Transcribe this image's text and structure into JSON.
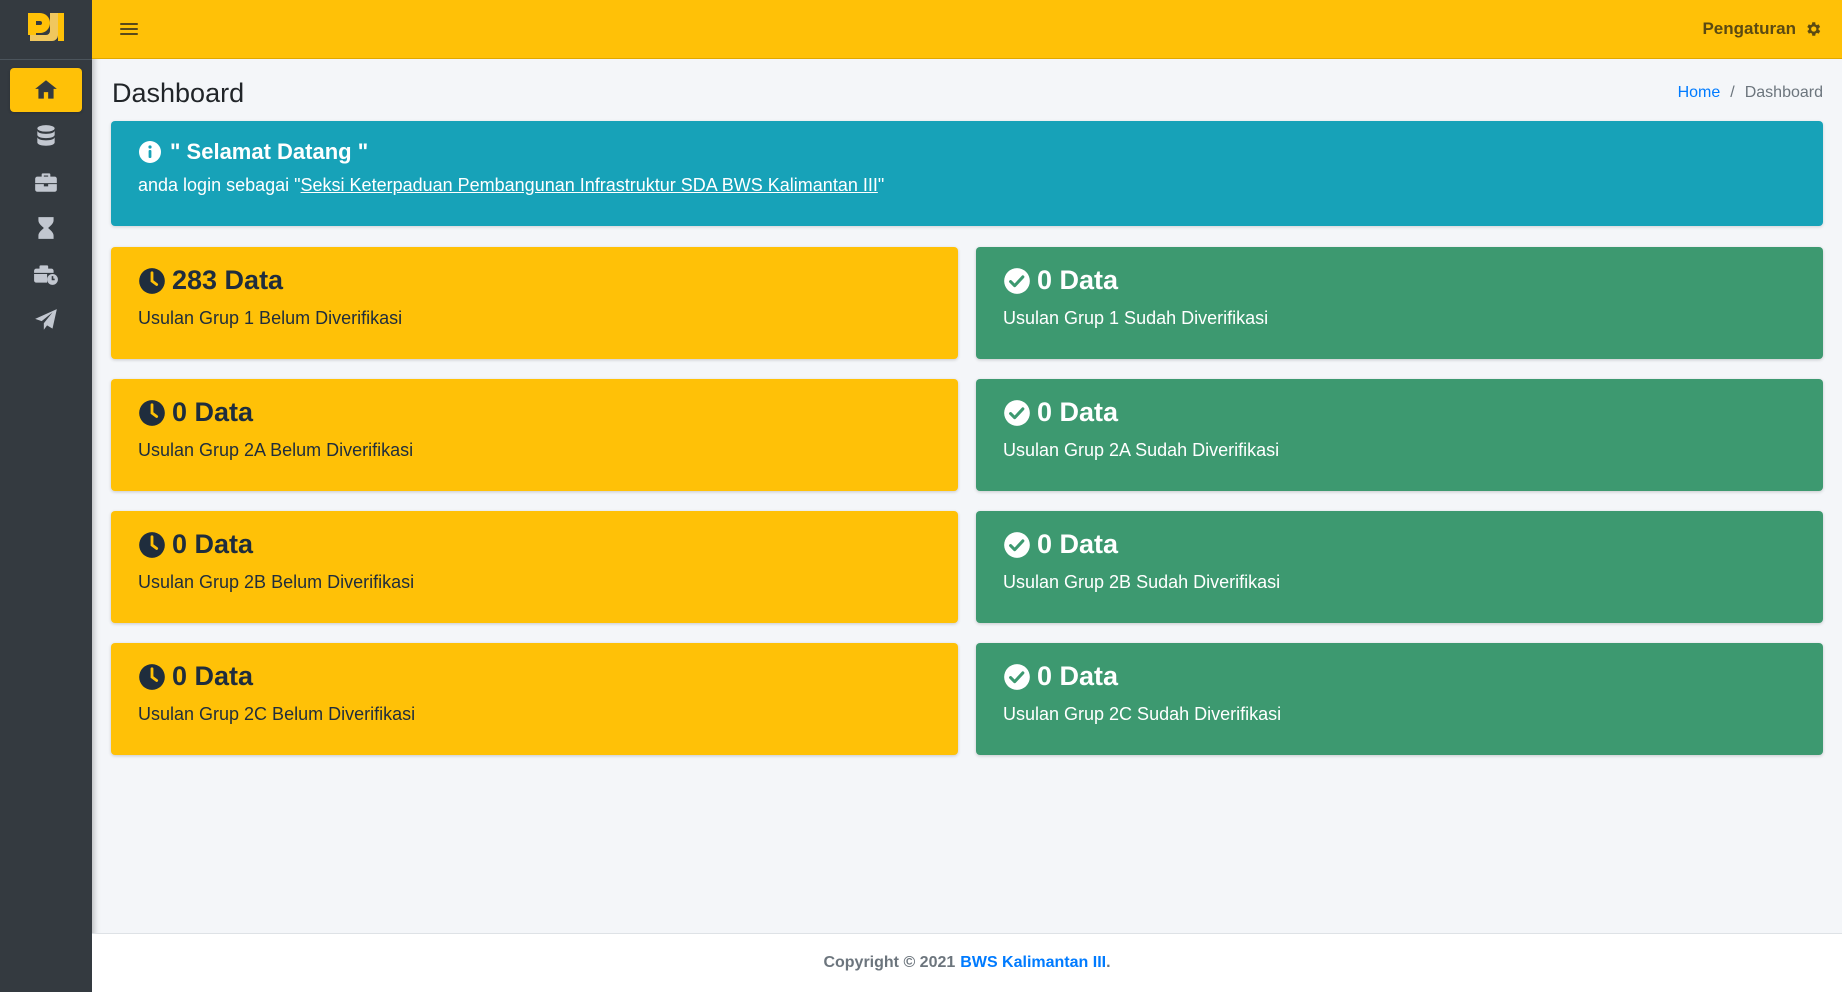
{
  "topbar": {
    "settings_label": "Pengaturan"
  },
  "header": {
    "title": "Dashboard"
  },
  "breadcrumb": {
    "home": "Home",
    "separator": "/",
    "current": "Dashboard"
  },
  "welcome": {
    "title": "\" Selamat Datang \"",
    "prefix": "anda login sebagai \"",
    "user": "Seksi Keterpaduan Pembangunan Infrastruktur SDA BWS Kalimantan III",
    "suffix": "\""
  },
  "sidebar": {
    "items": [
      {
        "icon": "home-icon",
        "active": true
      },
      {
        "icon": "database-icon"
      },
      {
        "icon": "briefcase-icon"
      },
      {
        "icon": "hourglass-icon"
      },
      {
        "icon": "business-time-icon"
      },
      {
        "icon": "paper-plane-icon"
      }
    ]
  },
  "cards": [
    {
      "count": "283 Data",
      "label": "Usulan Grup 1 Belum Diverifikasi",
      "status": "pending"
    },
    {
      "count": "0 Data",
      "label": "Usulan Grup 1 Sudah Diverifikasi",
      "status": "verified"
    },
    {
      "count": "0 Data",
      "label": "Usulan Grup 2A Belum Diverifikasi",
      "status": "pending"
    },
    {
      "count": "0 Data",
      "label": "Usulan Grup 2A Sudah Diverifikasi",
      "status": "verified"
    },
    {
      "count": "0 Data",
      "label": "Usulan Grup 2B Belum Diverifikasi",
      "status": "pending"
    },
    {
      "count": "0 Data",
      "label": "Usulan Grup 2B Sudah Diverifikasi",
      "status": "verified"
    },
    {
      "count": "0 Data",
      "label": "Usulan Grup 2C Belum Diverifikasi",
      "status": "pending"
    },
    {
      "count": "0 Data",
      "label": "Usulan Grup 2C Sudah Diverifikasi",
      "status": "verified"
    }
  ],
  "footer": {
    "prefix": "Copyright © 2021",
    "org": "BWS Kalimantan III",
    "suffix": "."
  },
  "colors": {
    "warning": "#ffc107",
    "success": "#3d9970",
    "info": "#17a2b8",
    "sidebar": "#343a40"
  }
}
